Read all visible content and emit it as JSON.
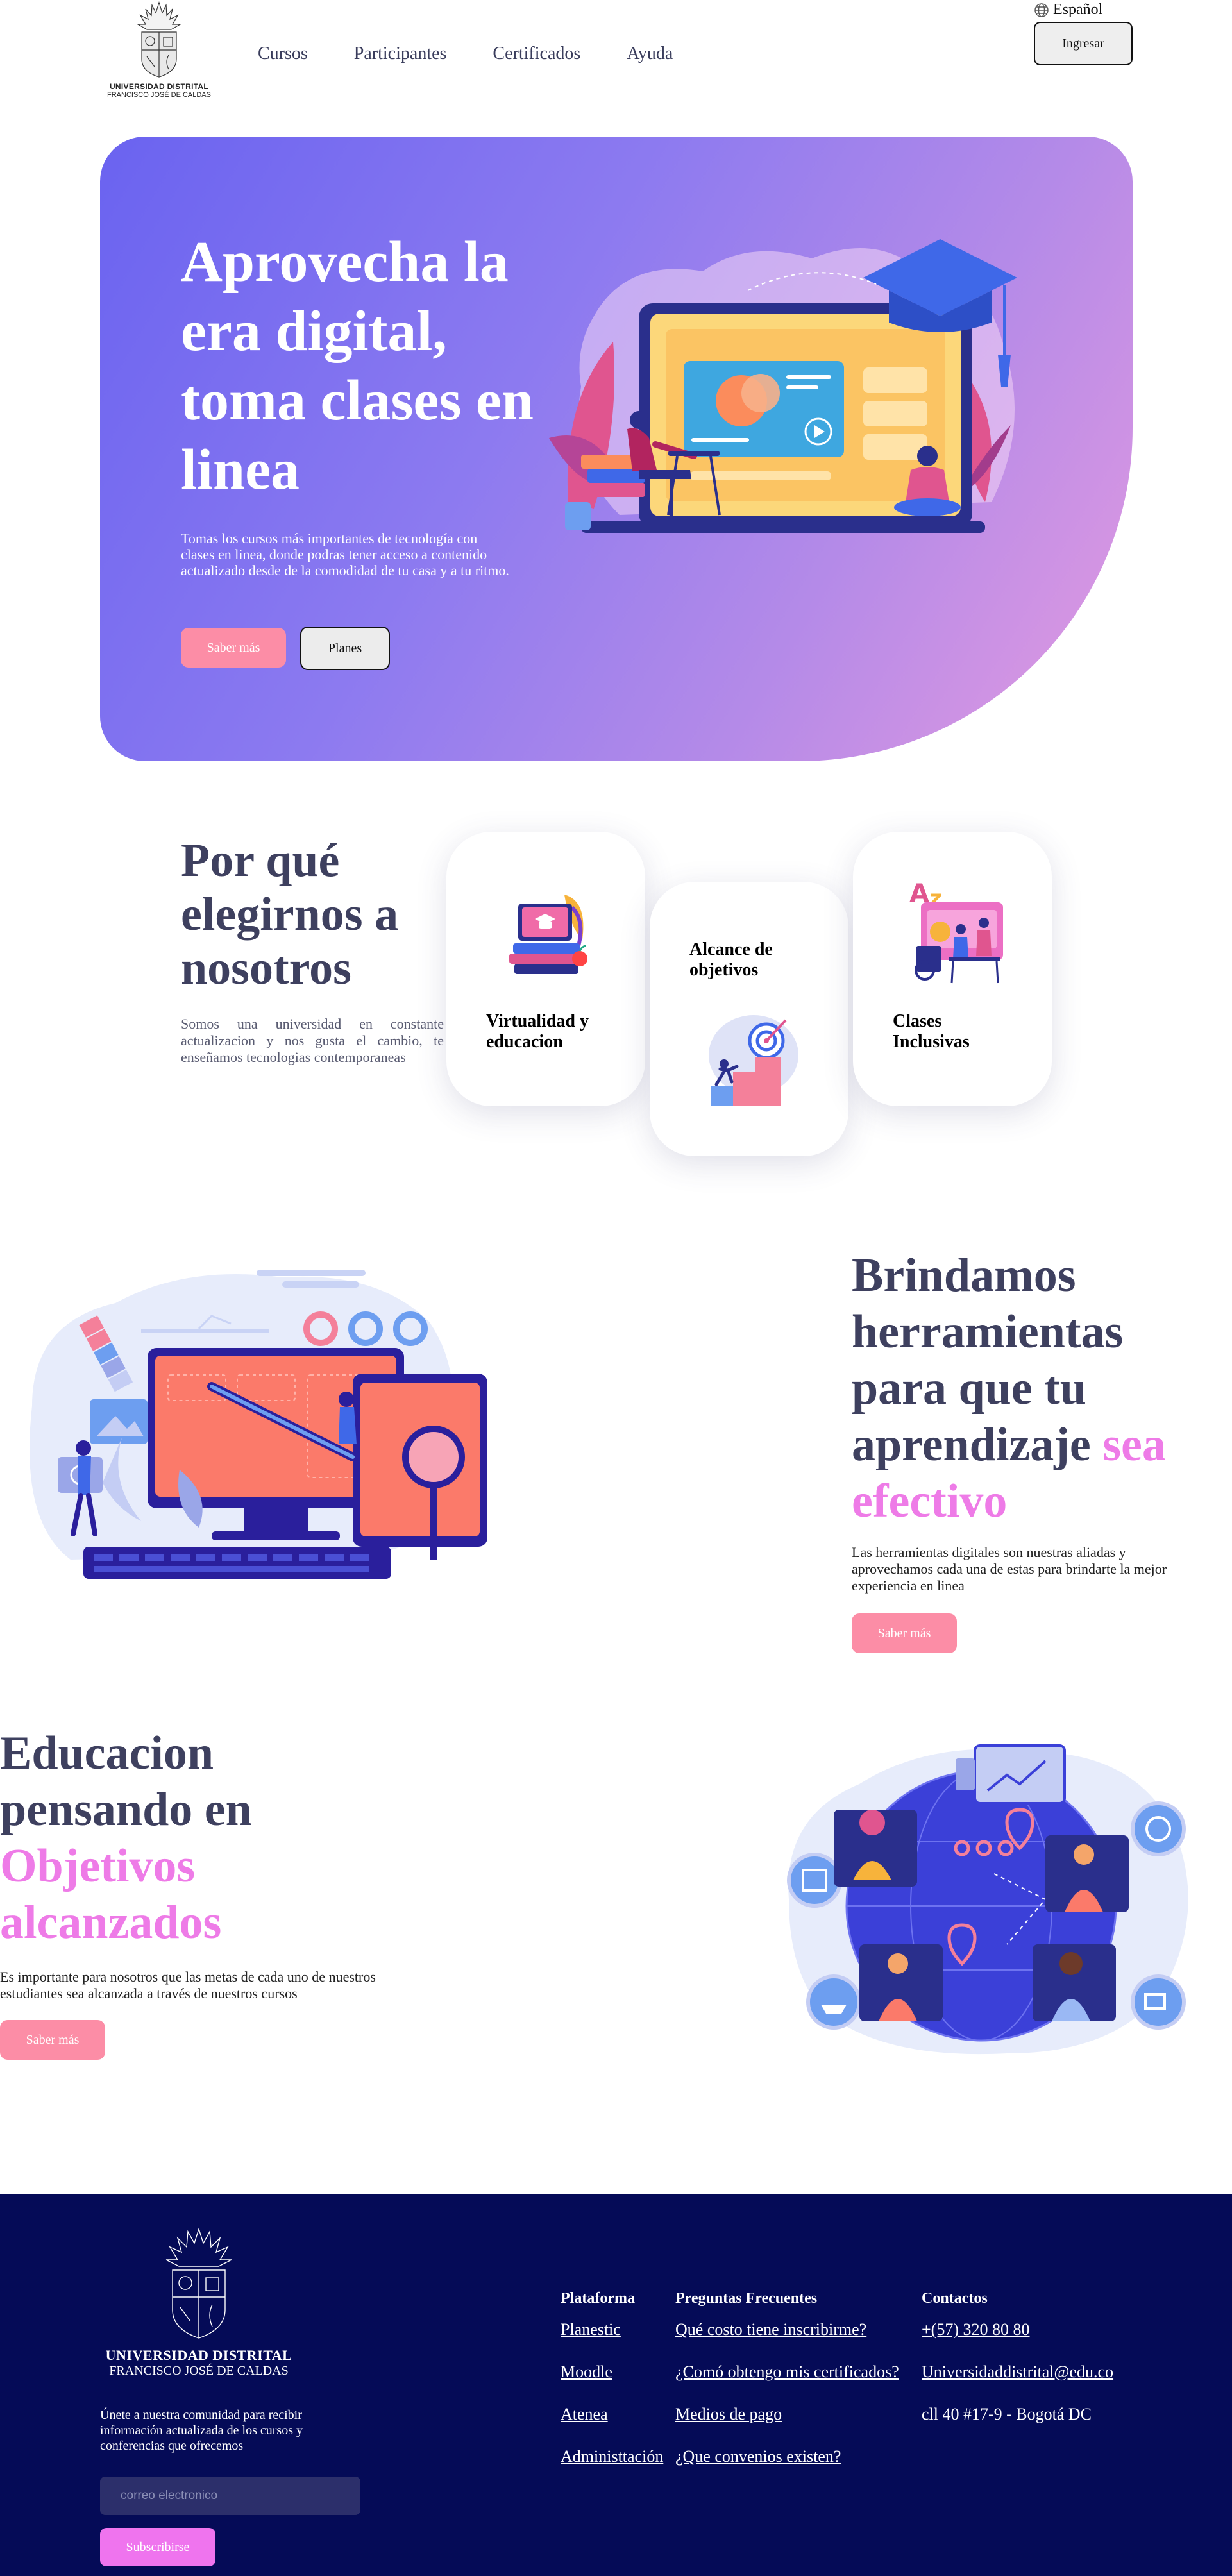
{
  "header": {
    "logo": {
      "name": "UNIVERSIDAD DISTRITAL",
      "sub": "FRANCISCO JOSÉ DE CALDAS"
    },
    "nav": [
      "Cursos",
      "Participantes",
      "Certificados",
      "Ayuda"
    ],
    "language": "Español",
    "login_label": "Ingresar"
  },
  "hero": {
    "title": "Aprovecha la era digital, toma clases en linea",
    "description": "Tomas los cursos más importantes de tecnología con clases en linea, donde podras tener acceso a contenido actualizado desde de la comodidad de tu casa y a tu ritmo.",
    "more_label": "Saber más",
    "plans_label": "Planes"
  },
  "why": {
    "title": "Por qué elegirnos a nosotros",
    "text": "Somos una universidad en constante actualizacion y nos gusta el cambio, te enseñamos tecnologias contemporaneas",
    "cards": [
      {
        "label": "Virtualidad y educacion"
      },
      {
        "label": "Alcance de objetivos"
      },
      {
        "label": "Clases Inclusivas"
      }
    ]
  },
  "tools": {
    "title": "Brindamos herramientas para que tu aprendizaje",
    "highlight": "sea efectivo",
    "text": "Las herramientas digitales son nuestras aliadas y aprovechamos cada una de estas para brindarte la mejor experiencia en linea",
    "button_label": "Saber más"
  },
  "goals": {
    "title": "Educacion pensando en",
    "highlight": "Objetivos alcanzados",
    "text": "Es importante para nosotros que las metas de cada uno de nuestros estudiantes sea alcanzada a través de nuestros cursos",
    "button_label": "Saber más"
  },
  "footer": {
    "logo_name": "UNIVERSIDAD DISTRITAL",
    "logo_sub": "FRANCISCO JOSÉ DE CALDAS",
    "newsletter_text": "Únete a nuestra comunidad para recibir información actualizada de los cursos y conferencias que ofrecemos",
    "email_placeholder": "correo electronico",
    "subscribe_label": "Subscribirse",
    "columns": [
      {
        "title": "Plataforma",
        "links": [
          "Planestic",
          "Moodle",
          "Atenea",
          "Administtación"
        ]
      },
      {
        "title": "Preguntas Frecuentes",
        "links": [
          "Qué costo tiene inscribirme?",
          "¿Comó obtengo mis certificados?",
          "Medios de pago",
          "¿Que convenios existen?"
        ]
      },
      {
        "title": "Contactos",
        "links": [
          "+(57) 320 80 80",
          "Universidaddistrital@edu.co"
        ],
        "address": "cll 40 #17-9 - Bogotá DC"
      }
    ]
  },
  "colors": {
    "accent_pink": "#fc8da6",
    "highlight": "#ee7be7",
    "footer_bg": "#050b57",
    "heading": "#3e405f"
  }
}
